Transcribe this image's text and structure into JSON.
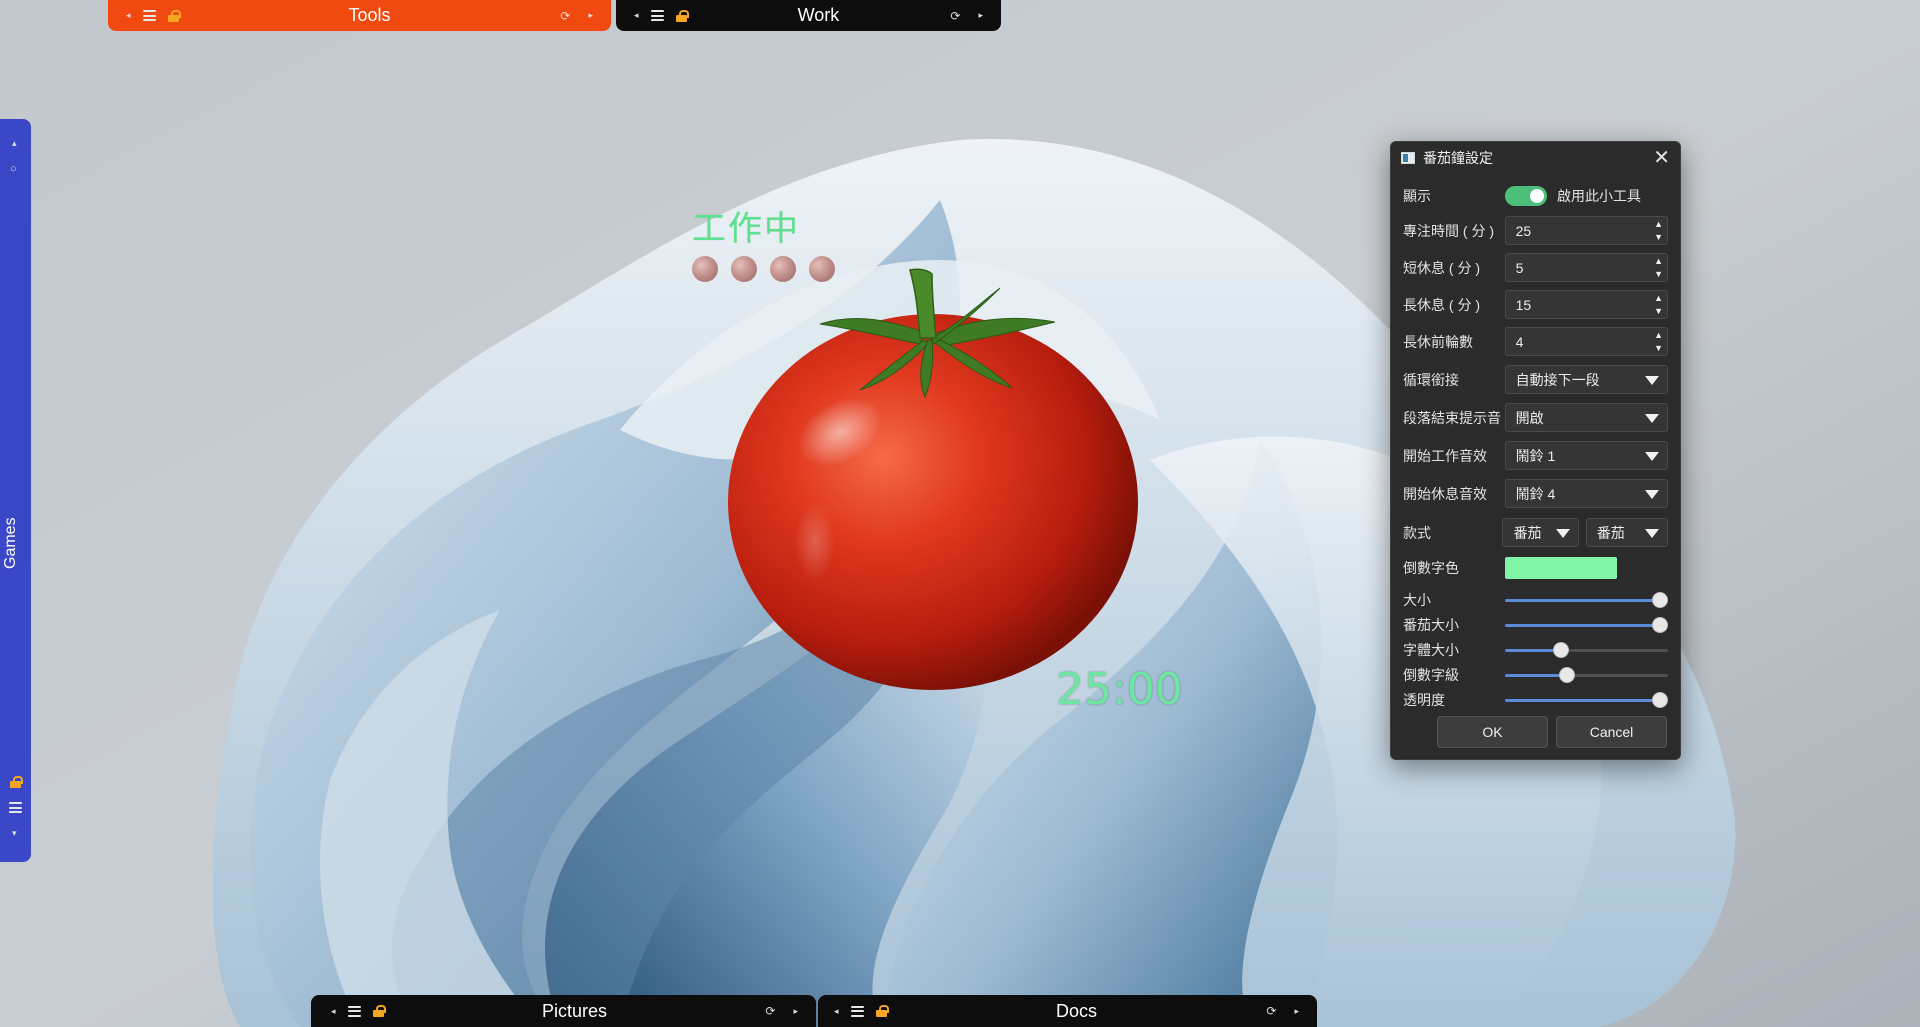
{
  "fences": {
    "tools": {
      "title": "Tools",
      "color": "#f04a10"
    },
    "work": {
      "title": "Work",
      "color": "#0d0d0d"
    },
    "games": {
      "title": "Games",
      "color": "#3a48c8"
    },
    "pictures": {
      "title": "Pictures",
      "color": "#0d0d0d"
    },
    "docs": {
      "title": "Docs",
      "color": "#0d0d0d"
    }
  },
  "widget": {
    "status": "工作中",
    "rounds": 4,
    "time": "25:00",
    "countdown_color": "#6ee6a2"
  },
  "dialog": {
    "title": "番茄鐘設定",
    "show_label": "顯示",
    "enable_label": "啟用此小工具",
    "enabled": true,
    "focus_label": "專注時間 ( 分 )",
    "focus_value": "25",
    "short_break_label": "短休息 ( 分 )",
    "short_break_value": "5",
    "long_break_label": "長休息 ( 分 )",
    "long_break_value": "15",
    "rounds_label": "長休前輪數",
    "rounds_value": "4",
    "loop_label": "循環銜接",
    "loop_value": "自動接下一段",
    "end_sound_label": "段落結束提示音",
    "end_sound_value": "開啟",
    "work_sound_label": "開始工作音效",
    "work_sound_value": "鬧鈴 1",
    "break_sound_label": "開始休息音效",
    "break_sound_value": "鬧鈴 4",
    "style_label": "款式",
    "style_value_1": "番茄",
    "style_value_2": "番茄",
    "countdown_color_label": "倒數字色",
    "countdown_color": "#80f5a6",
    "size_label": "大小",
    "size_level": 1.0,
    "tomato_size_label": "番茄大小",
    "tomato_size_level": 1.0,
    "font_size_label": "字體大小",
    "font_size_level": 0.33,
    "countdown_level_label": "倒數字級",
    "countdown_level": 0.37,
    "opacity_label": "透明度",
    "opacity_level": 1.0,
    "ok_label": "OK",
    "cancel_label": "Cancel"
  }
}
